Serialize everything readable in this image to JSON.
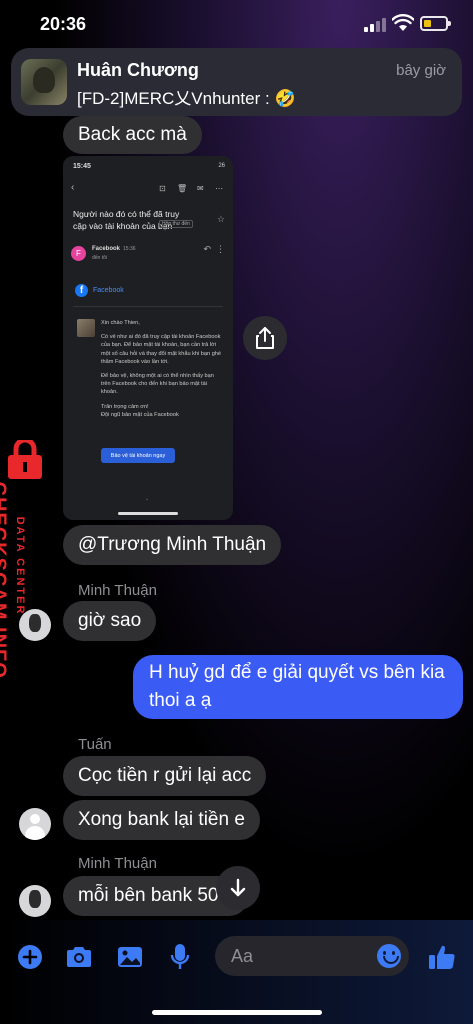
{
  "status_bar": {
    "time": "20:36"
  },
  "notification": {
    "sender": "Huân Chương",
    "time": "bây giờ",
    "message": "[FD-2]MERC乂Vnhunter : 🤣"
  },
  "messages": {
    "back_acc": "Back acc mà",
    "mention": "@Trương Minh Thuận",
    "sender_minh_1": "Minh Thuận",
    "gio_sao": "giờ sao",
    "outgoing": "H huỷ gd để e giải quyết vs bên kia thoi a ạ",
    "sender_tuan": "Tuấn",
    "coc_tien": "Cọc tiền r gửi lại acc",
    "xong_bank": "Xong bank lại tiền e",
    "sender_minh_2": "Minh Thuận",
    "moi_ben": "mỗi bên bank 50"
  },
  "embedded_screenshot": {
    "time": "15:45",
    "battery": "26",
    "subject": "Người nào đó có thể đã truy cập vào tài khoản của bạn",
    "tag": "Hộp thư đến",
    "from_initial": "F",
    "from_name": "Facebook",
    "from_time": "15:36",
    "to_line": "đến tôi",
    "brand": "Facebook",
    "greeting": "Xin chào Thien,",
    "para1": "Có vẻ như ai đó đã truy cập tài khoản Facebook của bạn. Để bảo mật tài khoản, bạn cần trả lời một số câu hỏi và thay đổi mật khẩu khi bạn ghé thăm Facebook vào lần tới.",
    "para2": "Để bảo vệ, không một ai có thể nhìn thấy bạn trên Facebook cho đến khi bạn bảo mật tài khoản.",
    "para3": "Trân trọng cảm ơn!",
    "para4": "Đội ngũ bảo mật của Facebook",
    "cta": "Bảo vệ tài khoản ngay"
  },
  "watermark": {
    "line1": "DATA CENTER",
    "line2": "CHECKSCAM.INFO"
  },
  "composer": {
    "placeholder": "Aa"
  },
  "colors": {
    "outgoing_bubble": "#3b5bf5",
    "incoming_bubble": "#303033",
    "watermark": "#e8282a"
  }
}
